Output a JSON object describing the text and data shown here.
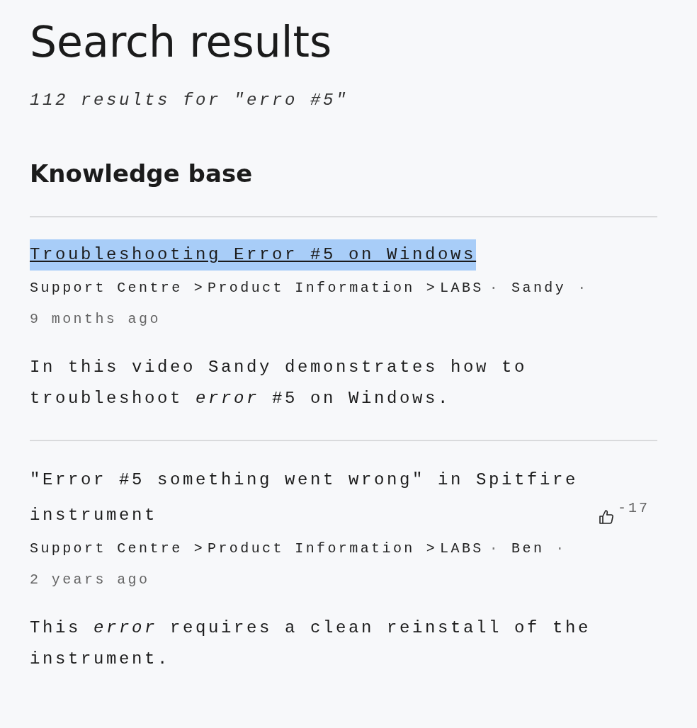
{
  "title": "Search results",
  "summary": "112 results for \"erro #5\"",
  "section": "Knowledge base",
  "results": [
    {
      "title": "Troubleshooting Error #5 on Windows",
      "selected": true,
      "breadcrumbs": [
        {
          "label": "Support Centre"
        },
        {
          "sep": ">",
          "label": "Product Information"
        },
        {
          "sep": ">",
          "label": "LABS"
        }
      ],
      "author_sep": "·",
      "author": "Sandy",
      "time_sep": "·",
      "time": "9 months ago",
      "snippet": "In this video Sandy demonstrates how to troubleshoot *error* #5 on Windows."
    },
    {
      "title": "\"Error #5 something went wrong\" in Spitfire instrument",
      "selected": false,
      "votes": "-17",
      "breadcrumbs": [
        {
          "label": "Support Centre"
        },
        {
          "sep": ">",
          "label": "Product Information"
        },
        {
          "sep": ">",
          "label": "LABS"
        }
      ],
      "author_sep": "·",
      "author": "Ben",
      "time_sep": "·",
      "time": "2 years ago",
      "snippet": "This *error* requires a clean reinstall of the instrument."
    }
  ]
}
